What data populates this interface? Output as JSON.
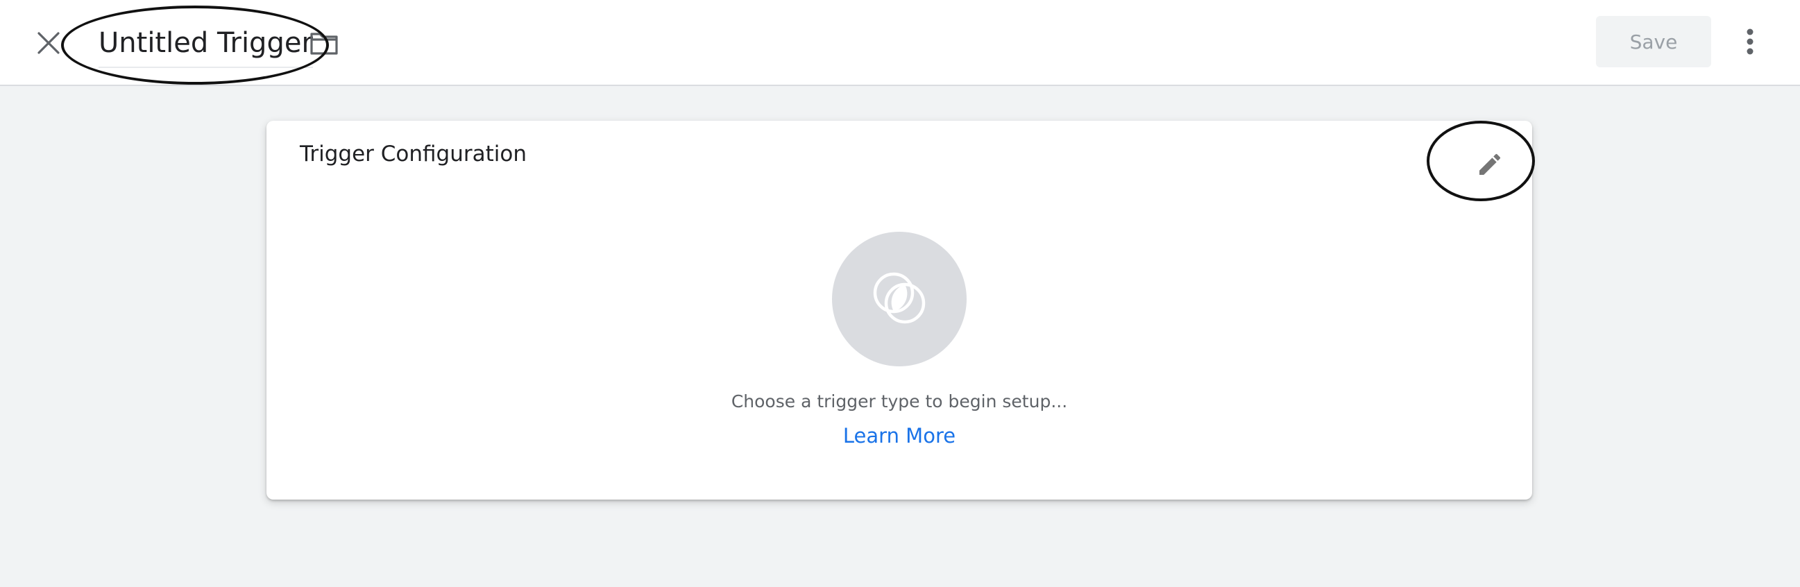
{
  "header": {
    "title": "Untitled Trigger",
    "close_icon": "close-icon",
    "folder_icon": "folder-icon",
    "save_label": "Save",
    "more_icon": "more-vert-icon"
  },
  "card": {
    "title": "Trigger Configuration",
    "edit_icon": "pencil-icon",
    "trigger_type_icon": "trigger-type-icon",
    "prompt": "Choose a trigger type to begin setup...",
    "learn_more": "Learn More"
  },
  "colors": {
    "page_background": "#f1f3f4",
    "link": "#1a73e8",
    "icon_circle": "#dadce0",
    "save_disabled_text": "#9aa0a6"
  }
}
